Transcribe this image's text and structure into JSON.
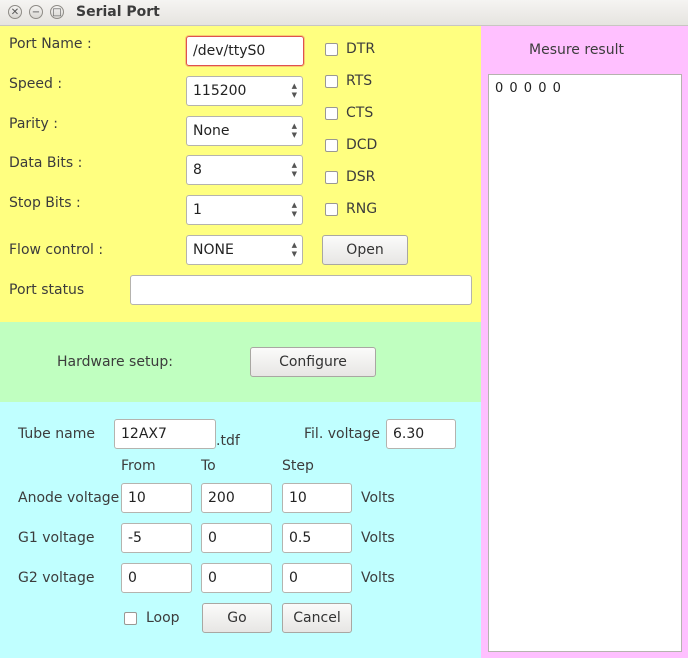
{
  "window": {
    "title": "Serial Port"
  },
  "port": {
    "port_name_label": "Port Name :",
    "port_name_value": "/dev/ttyS0",
    "speed_label": "Speed :",
    "speed_value": "115200",
    "parity_label": "Parity :",
    "parity_value": "None",
    "data_bits_label": "Data Bits :",
    "data_bits_value": "8",
    "stop_bits_label": "Stop Bits :",
    "stop_bits_value": "1",
    "flow_label": "Flow control :",
    "flow_value": "NONE",
    "status_label": "Port status",
    "status_value": "",
    "open_label": "Open",
    "signals": [
      "DTR",
      "RTS",
      "CTS",
      "DCD",
      "DSR",
      "RNG"
    ]
  },
  "hardware": {
    "label": "Hardware setup:",
    "configure_label": "Configure"
  },
  "tube": {
    "name_label": "Tube name",
    "name_value": "12AX7",
    "ext": ".tdf",
    "fil_label": "Fil. voltage",
    "fil_value": "6.30",
    "col_from": "From",
    "col_to": "To",
    "col_step": "Step",
    "rows": [
      {
        "label": "Anode voltage",
        "from": "10",
        "to": "200",
        "step": "10",
        "unit": "Volts"
      },
      {
        "label": "G1 voltage",
        "from": "-5",
        "to": "0",
        "step": "0.5",
        "unit": "Volts"
      },
      {
        "label": "G2 voltage",
        "from": "0",
        "to": "0",
        "step": "0",
        "unit": "Volts"
      }
    ],
    "loop_label": "Loop",
    "go_label": "Go",
    "cancel_label": "Cancel"
  },
  "result": {
    "title": "Mesure result",
    "text": "0 0 0 0 0"
  }
}
